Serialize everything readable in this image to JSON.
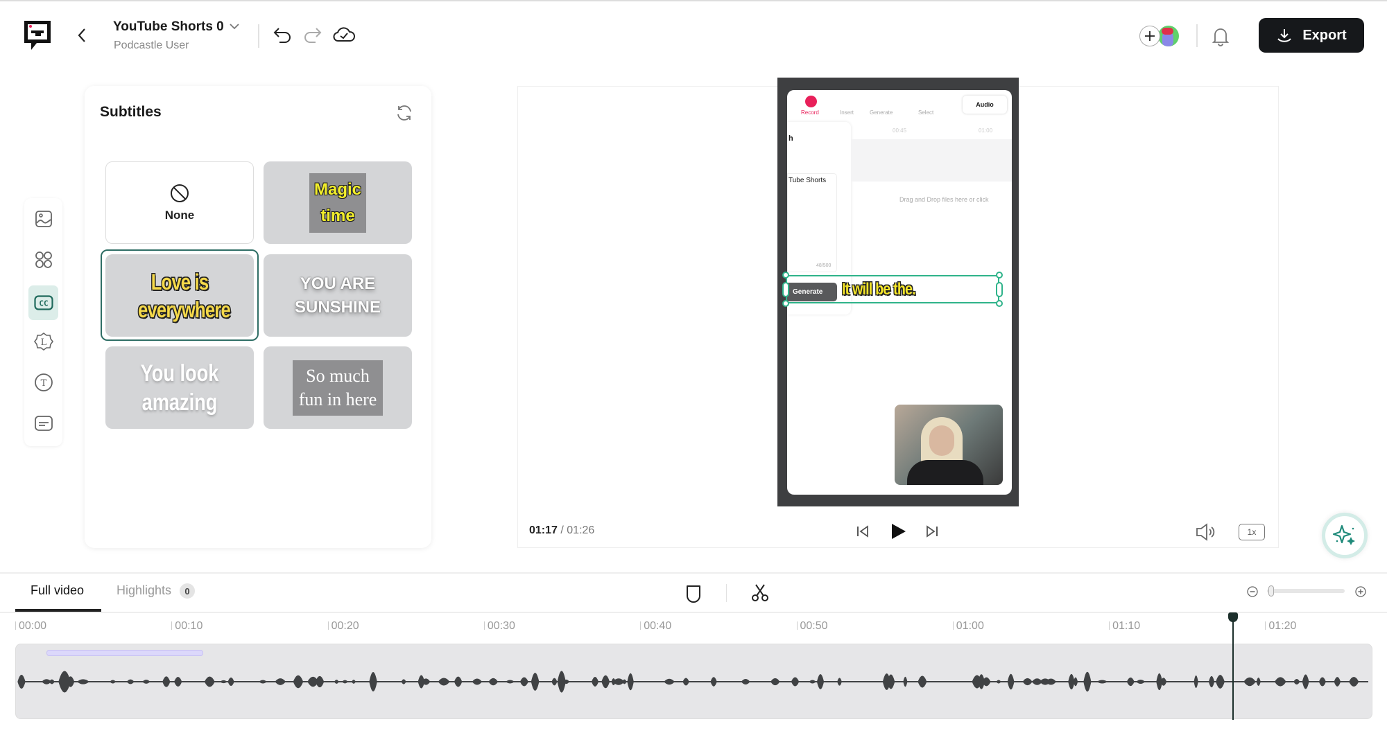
{
  "header": {
    "project_title": "YouTube Shorts 0",
    "owner": "Podcastle User",
    "export_label": "Export"
  },
  "subtitles_panel": {
    "title": "Subtitles",
    "styles": [
      {
        "label": "None",
        "selected": false
      },
      {
        "label": "Magic time",
        "selected": false
      },
      {
        "label": "Love is everywhere",
        "selected": true
      },
      {
        "label": "YOU ARE SUNSHINE",
        "selected": false
      },
      {
        "label": "You look amazing",
        "selected": false
      },
      {
        "label": "So much fun in here",
        "selected": false
      }
    ]
  },
  "sidebar": {
    "items": [
      {
        "icon": "image-icon"
      },
      {
        "icon": "grid-icon"
      },
      {
        "icon": "closed-captions-icon",
        "active": true
      },
      {
        "icon": "logo-badge-icon"
      },
      {
        "icon": "text-icon"
      },
      {
        "icon": "subtitle-box-icon"
      }
    ]
  },
  "preview": {
    "inner_toolbar": [
      "Record",
      "Insert",
      "Generate",
      "Select"
    ],
    "inner_audio": "Audio",
    "inner_tab_partial": "h",
    "inner_card_text": "Tube Shorts",
    "inner_counter": "48/500",
    "inner_times": [
      "00:45",
      "01:00"
    ],
    "inner_drop": "Drag and Drop files here or click",
    "inner_generate": "Generate",
    "caption": "It will be the.",
    "current_time": "01:17",
    "total_time": "01:26",
    "speed": "1x"
  },
  "timeline": {
    "tabs": [
      {
        "label": "Full video",
        "active": true
      },
      {
        "label": "Highlights",
        "count": "0"
      }
    ],
    "ticks": [
      "00:00",
      "00:10",
      "00:20",
      "00:30",
      "00:40",
      "00:50",
      "01:00",
      "01:10",
      "01:20"
    ],
    "playhead_time": "01:17",
    "zoom_level": 0.02
  },
  "colors": {
    "accent": "#1f7a6c",
    "export_bg": "#16181b",
    "record": "#e8205a",
    "waveform": "#404244"
  }
}
